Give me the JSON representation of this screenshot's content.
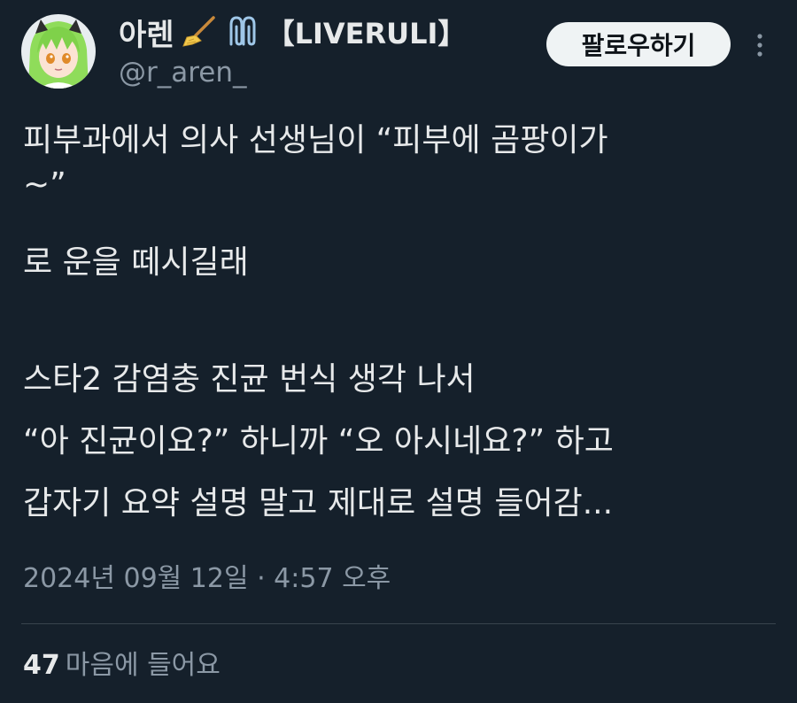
{
  "author": {
    "display_name": "아렌",
    "name_emojis": [
      "broom-emoji",
      "paperclip-emoji"
    ],
    "name_tag": "【LIVERULI】",
    "handle": "@r_aren_",
    "avatar_icon": "anime-avatar"
  },
  "actions": {
    "follow_label": "팔로우하기",
    "more_icon": "more-vertical-icon"
  },
  "tweet": {
    "lines": [
      "피부과에서 의사 선생님이 “피부에 곰팡이가",
      "~”",
      "로 운을 떼시길래",
      "",
      "스타2 감염충 진균 번식 생각 나서",
      "“아 진균이요?” 하니까 “오 아시네요?” 하고",
      "갑자기 요약 설명 말고 제대로 설명 들어감..."
    ],
    "timestamp": "2024년 09월 12일 · 4:57 오후"
  },
  "stats": {
    "likes_count": "47",
    "likes_label": "마음에 들어요"
  },
  "colors": {
    "background": "#15202b",
    "text_primary": "#e7e9ea",
    "text_secondary": "#8b98a5",
    "divider": "#38444d",
    "button_bg": "#eff3f4"
  }
}
